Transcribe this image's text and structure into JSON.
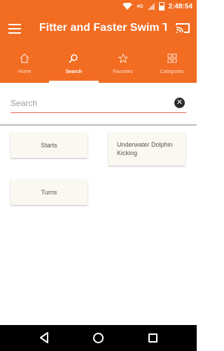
{
  "status": {
    "network": "4G",
    "time": "2:48:54"
  },
  "appbar": {
    "title": "Fitter and Faster Swim T..."
  },
  "tabs": [
    {
      "label": "Home",
      "icon": "home-icon"
    },
    {
      "label": "Search",
      "icon": "search-icon",
      "active": true
    },
    {
      "label": "Favorites",
      "icon": "star-icon"
    },
    {
      "label": "Categories",
      "icon": "grid-icon"
    }
  ],
  "search": {
    "placeholder": "Search",
    "value": ""
  },
  "results": [
    {
      "label": "Starts"
    },
    {
      "label": "Underwater Dolphin Kicking"
    },
    {
      "label": "Turns"
    }
  ],
  "colors": {
    "primary": "#f26c21",
    "input_underline": "#e96b57",
    "card_bg": "#fbf8f1"
  }
}
